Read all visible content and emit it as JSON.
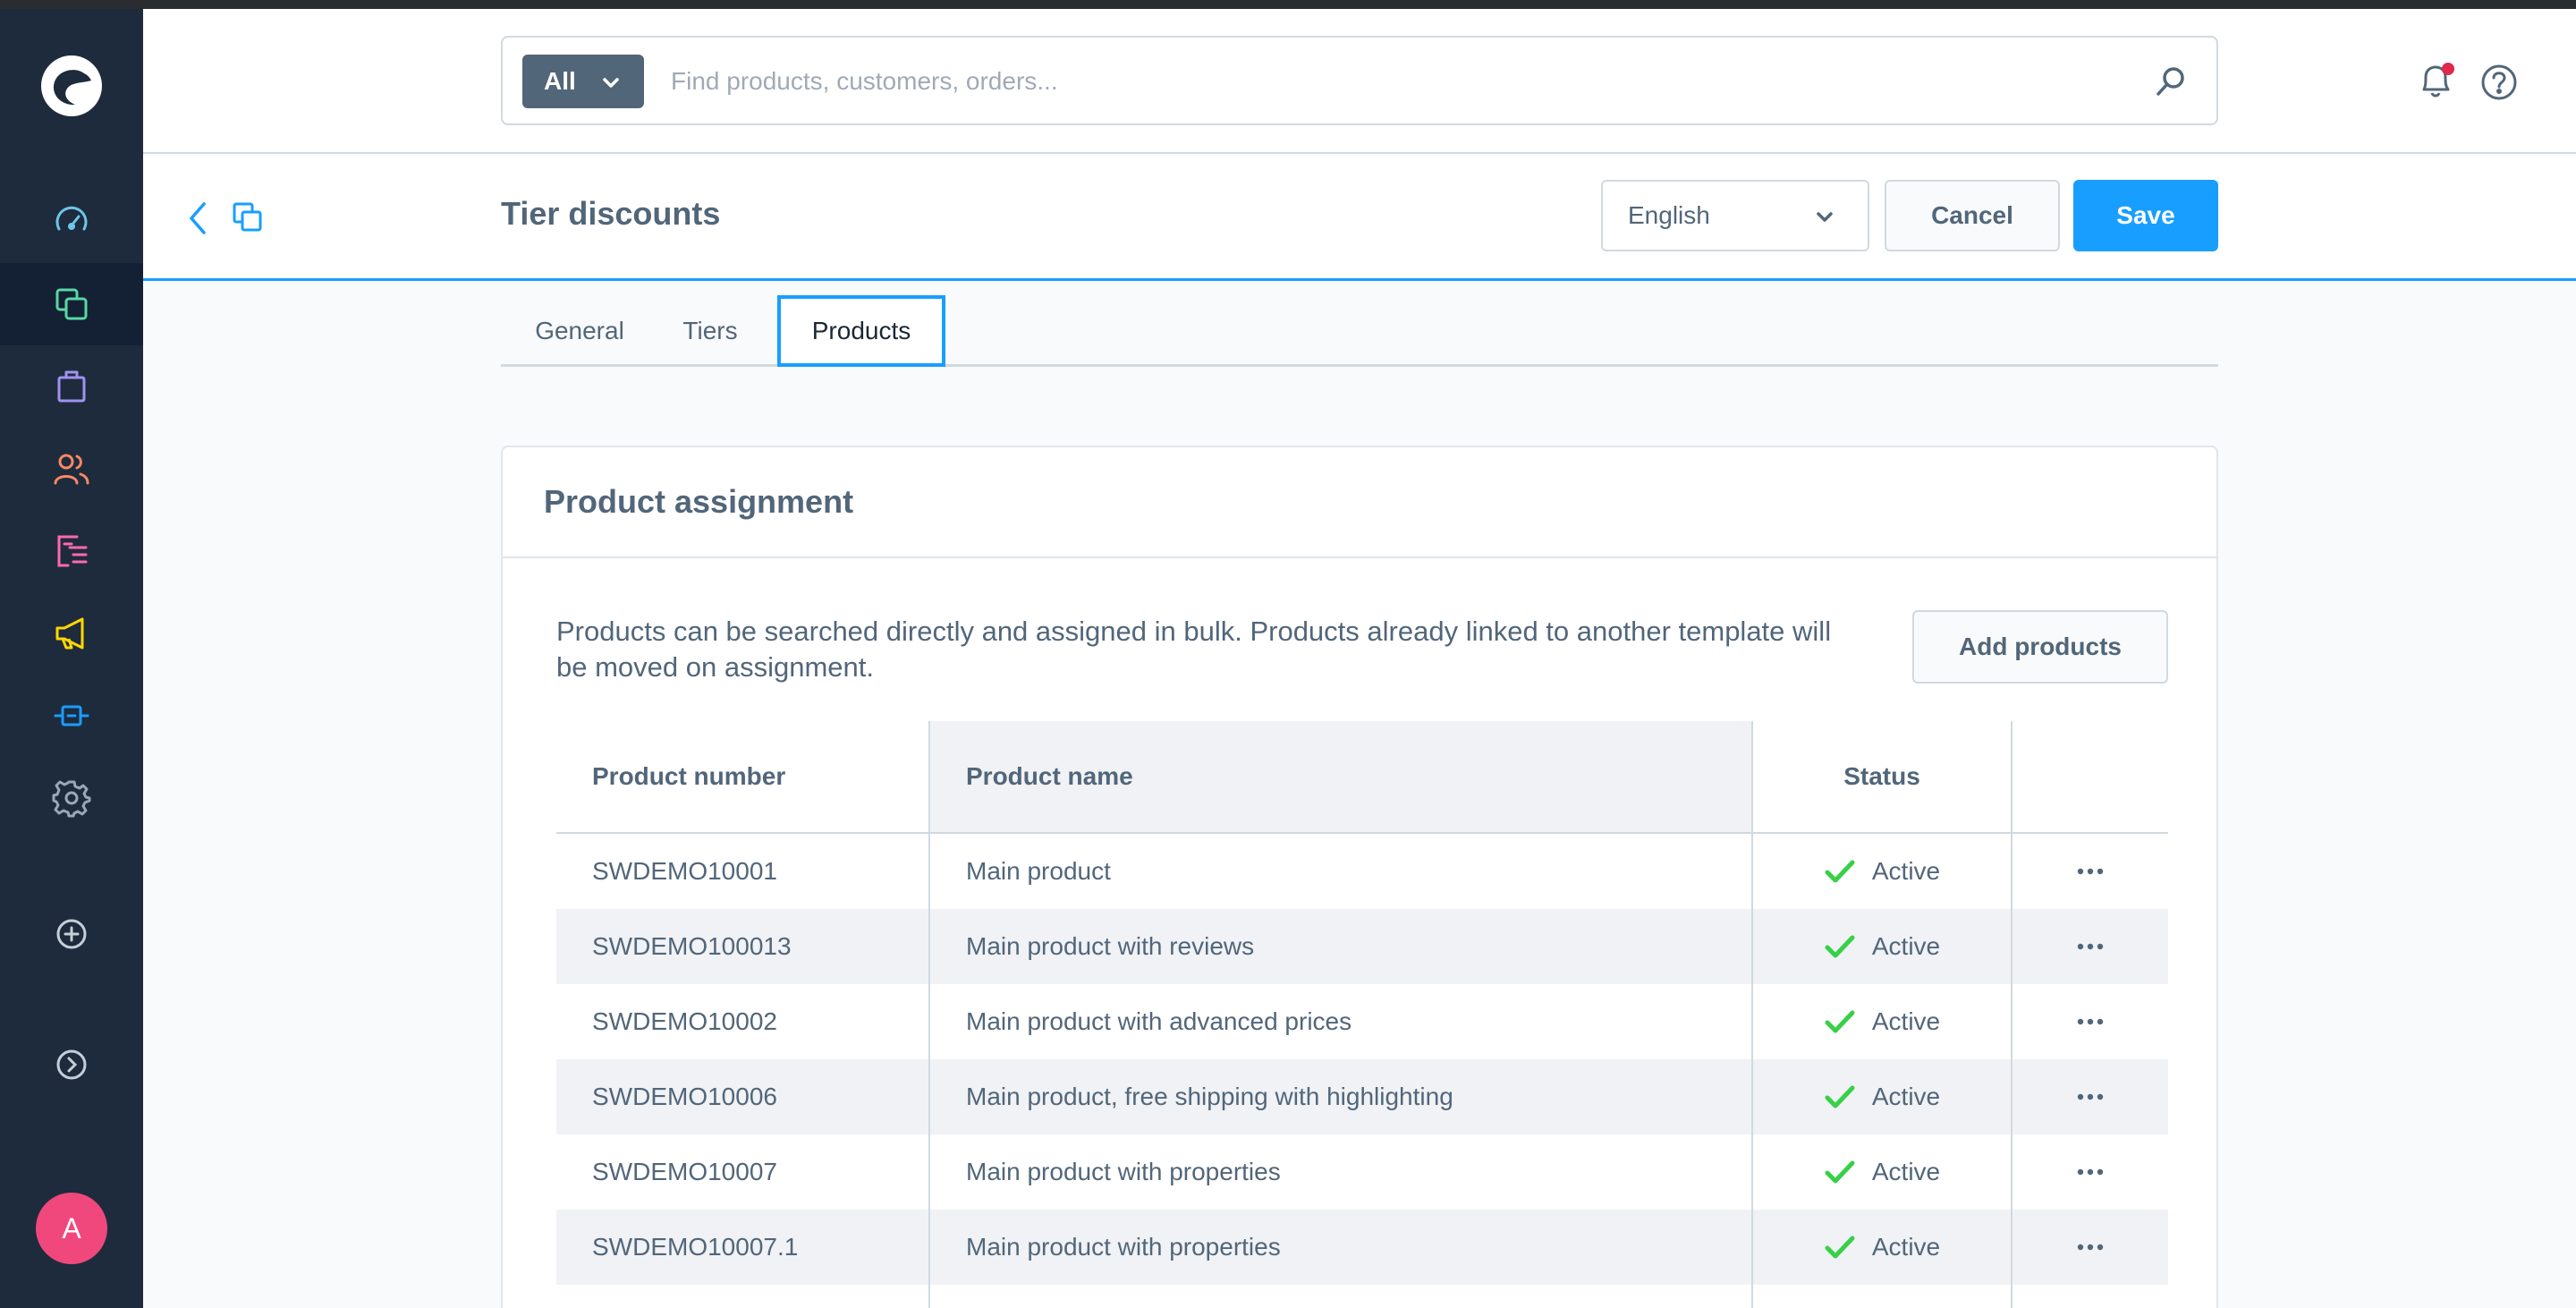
{
  "search": {
    "type_label": "All",
    "placeholder": "Find products, customers, orders..."
  },
  "page": {
    "title": "Tier discounts",
    "language": "English",
    "cancel_label": "Cancel",
    "save_label": "Save"
  },
  "tabs": [
    {
      "label": "General"
    },
    {
      "label": "Tiers"
    },
    {
      "label": "Products"
    }
  ],
  "card": {
    "title": "Product assignment",
    "description": "Products can be searched directly and assigned in bulk. Products already linked to another template will be moved on assignment.",
    "add_products_label": "Add products"
  },
  "table": {
    "columns": [
      "Product number",
      "Product name",
      "Status"
    ],
    "rows": [
      {
        "number": "SWDEMO10001",
        "name": "Main product",
        "status": "Active"
      },
      {
        "number": "SWDEMO100013",
        "name": "Main product with reviews",
        "status": "Active"
      },
      {
        "number": "SWDEMO10002",
        "name": "Main product with advanced prices",
        "status": "Active"
      },
      {
        "number": "SWDEMO10006",
        "name": "Main product, free shipping with highlighting",
        "status": "Active"
      },
      {
        "number": "SWDEMO10007",
        "name": "Main product with properties",
        "status": "Active"
      },
      {
        "number": "SWDEMO10007.1",
        "name": "Main product with properties",
        "status": "Active"
      }
    ]
  },
  "user": {
    "avatar_initial": "A"
  },
  "colors": {
    "sidebar": "#1e2b3d",
    "accent": "#189eff",
    "success": "#37d046",
    "avatar": "#f0487c",
    "notification_dot": "#de294c"
  }
}
